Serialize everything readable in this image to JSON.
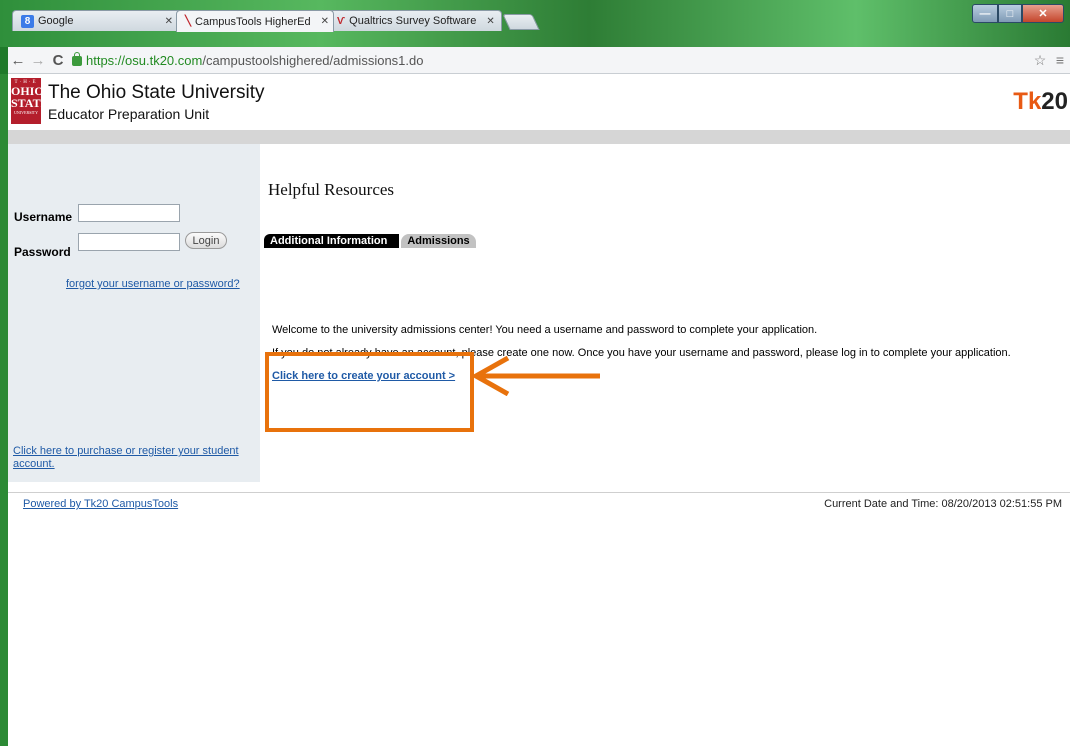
{
  "browser": {
    "tabs": [
      {
        "label": "Google",
        "icon": "google-favicon"
      },
      {
        "label": "CampusTools HigherEd",
        "icon": "campustools-favicon"
      },
      {
        "label": "Qualtrics Survey Software",
        "icon": "qualtrics-favicon"
      }
    ],
    "url_secure": "https://osu.tk20.com",
    "url_path": "/campustoolshighered/admissions1.do"
  },
  "header": {
    "logo_text": [
      "T·H·E",
      "OHIO",
      "STATE",
      "UNIVERSITY"
    ],
    "university": "The Ohio State University",
    "unit": "Educator Preparation Unit",
    "brand_tk": "Tk",
    "brand_20": "20"
  },
  "sidebar": {
    "username_label": "Username",
    "password_label": "Password",
    "login_label": "Login",
    "forgot_link": "forgot your username or password?",
    "purchase_link_line1": "Click here to purchase or register your student",
    "purchase_link_line2": "account."
  },
  "content": {
    "title": "Helpful Resources",
    "tabs": [
      {
        "label": "Additional Information",
        "active": true
      },
      {
        "label": "Admissions",
        "active": false
      }
    ],
    "welcome": "Welcome to the university admissions center! You need a username and password to complete your application.",
    "instruction": "If you do not already have an account, please create one now. Once you have your username and password, please log in to complete your application.",
    "create_link": "Click here to create your account >"
  },
  "footer": {
    "powered_by": "Powered by Tk20 CampusTools",
    "datetime": "Current Date and Time: 08/20/2013 02:51:55 PM"
  },
  "colors": {
    "highlight": "#e8720c",
    "link": "#1f5aa6",
    "osu_red": "#b41e2c",
    "tk20_orange": "#e85a14"
  }
}
